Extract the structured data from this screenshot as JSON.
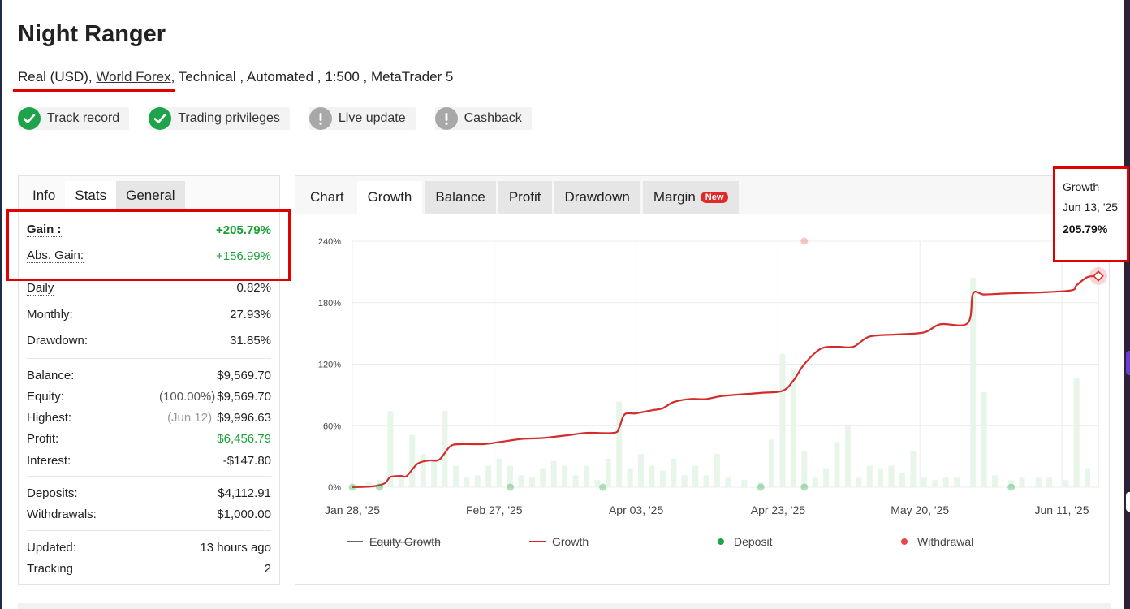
{
  "page": {
    "title": "Night Ranger",
    "subtitle": {
      "account": "Real (USD),",
      "broker": "World Forex",
      "rest": ", Technical , Automated , 1:500 , MetaTrader 5"
    }
  },
  "badges": [
    {
      "label": "Track record",
      "status": "ok",
      "icon": "check-icon"
    },
    {
      "label": "Trading privileges",
      "status": "ok",
      "icon": "check-icon"
    },
    {
      "label": "Live update",
      "status": "warn",
      "icon": "exclamation-icon"
    },
    {
      "label": "Cashback",
      "status": "warn",
      "icon": "exclamation-icon"
    }
  ],
  "left_tabs": {
    "info": "Info",
    "stats": "Stats",
    "general": "General"
  },
  "stats": {
    "gain": {
      "label": "Gain :",
      "value": "+205.79%"
    },
    "abs_gain": {
      "label": "Abs. Gain:",
      "value": "+156.99%"
    },
    "daily": {
      "label": "Daily",
      "value": "0.82%"
    },
    "monthly": {
      "label": "Monthly:",
      "value": "27.93%"
    },
    "drawdown": {
      "label": "Drawdown:",
      "value": "31.85%"
    },
    "balance": {
      "label": "Balance:",
      "value": "$9,569.70"
    },
    "equity": {
      "label": "Equity:",
      "note": "(100.00%)",
      "value": "$9,569.70"
    },
    "highest": {
      "label": "Highest:",
      "note": "(Jun 12)",
      "value": "$9,996.63"
    },
    "profit": {
      "label": "Profit:",
      "value": "$6,456.79"
    },
    "interest": {
      "label": "Interest:",
      "value": "-$147.80"
    },
    "deposits": {
      "label": "Deposits:",
      "value": "$4,112.91"
    },
    "withdrawals": {
      "label": "Withdrawals:",
      "value": "$1,000.00"
    },
    "updated": {
      "label": "Updated:",
      "value": "13 hours ago"
    },
    "tracking": {
      "label": "Tracking",
      "value": "2"
    }
  },
  "chart_tabs": {
    "chart": "Chart",
    "growth": "Growth",
    "balance": "Balance",
    "profit": "Profit",
    "drawdown": "Drawdown",
    "margin": "Margin",
    "new_badge": "New"
  },
  "tooltip": {
    "title": "Growth",
    "date": "Jun 13, '25",
    "value": "205.79%"
  },
  "colors": {
    "accent_red": "#e00000",
    "growth_line": "#d42b2b",
    "deposit_dot": "#1fa34a",
    "withdrawal_dot": "#e54848",
    "bar_fill": "#e8f5e9",
    "positive": "#18a034"
  },
  "chart_data": {
    "type": "line",
    "x_tick_labels": [
      "Jan 28, '25",
      "Feb 27, '25",
      "Apr 03, '25",
      "Apr 23, '25",
      "May 20, '25",
      "Jun 11, '25"
    ],
    "y_tick_labels": [
      "0%",
      "60%",
      "120%",
      "180%",
      "240%"
    ],
    "ylim": [
      0,
      240
    ],
    "x_range_days": [
      0,
      137
    ],
    "grid": true,
    "legend": [
      "Equity Growth",
      "Growth",
      "Deposit",
      "Withdrawal"
    ],
    "legend_placement": "bottom",
    "series": [
      {
        "name": "Growth",
        "points": [
          [
            0,
            0
          ],
          [
            4,
            1
          ],
          [
            6,
            4
          ],
          [
            7,
            10
          ],
          [
            9,
            11
          ],
          [
            10,
            11
          ],
          [
            12,
            23
          ],
          [
            14,
            26
          ],
          [
            16,
            27
          ],
          [
            18,
            40
          ],
          [
            20,
            42
          ],
          [
            24,
            42
          ],
          [
            27,
            44
          ],
          [
            31,
            47
          ],
          [
            35,
            48
          ],
          [
            40,
            51
          ],
          [
            43,
            53
          ],
          [
            48,
            53
          ],
          [
            49,
            58
          ],
          [
            50,
            71
          ],
          [
            52,
            72
          ],
          [
            55,
            75
          ],
          [
            57,
            77
          ],
          [
            59,
            83
          ],
          [
            62,
            86
          ],
          [
            65,
            86
          ],
          [
            68,
            89
          ],
          [
            75,
            92
          ],
          [
            79,
            94
          ],
          [
            81,
            104
          ],
          [
            83,
            120
          ],
          [
            86,
            135
          ],
          [
            89,
            137
          ],
          [
            92,
            137
          ],
          [
            95,
            147
          ],
          [
            100,
            149
          ],
          [
            105,
            151
          ],
          [
            108,
            159
          ],
          [
            113,
            160
          ],
          [
            114,
            189
          ],
          [
            116,
            188
          ],
          [
            120,
            189
          ],
          [
            126,
            190
          ],
          [
            132,
            192
          ],
          [
            133,
            197
          ],
          [
            135,
            205
          ],
          [
            137,
            206
          ]
        ]
      }
    ],
    "deposit_markers_days": [
      0,
      5,
      29,
      46,
      75,
      83,
      121
    ],
    "withdrawal_markers": [
      [
        83,
        240
      ]
    ],
    "tooltip_point": [
      137,
      206
    ],
    "daily_bars_relative": [
      [
        3,
        0.02
      ],
      [
        5,
        0.03
      ],
      [
        7,
        0.32
      ],
      [
        9,
        0.05
      ],
      [
        11,
        0.22
      ],
      [
        13,
        0.14
      ],
      [
        15,
        0.12
      ],
      [
        17,
        0.32
      ],
      [
        19,
        0.09
      ],
      [
        21,
        0.04
      ],
      [
        23,
        0.05
      ],
      [
        25,
        0.09
      ],
      [
        27,
        0.12
      ],
      [
        29,
        0.09
      ],
      [
        31,
        0.05
      ],
      [
        33,
        0.04
      ],
      [
        35,
        0.08
      ],
      [
        37,
        0.11
      ],
      [
        39,
        0.09
      ],
      [
        41,
        0.05
      ],
      [
        43,
        0.09
      ],
      [
        45,
        0.03
      ],
      [
        47,
        0.12
      ],
      [
        49,
        0.36
      ],
      [
        51,
        0.08
      ],
      [
        53,
        0.14
      ],
      [
        55,
        0.09
      ],
      [
        57,
        0.07
      ],
      [
        59,
        0.12
      ],
      [
        61,
        0.05
      ],
      [
        63,
        0.09
      ],
      [
        65,
        0.05
      ],
      [
        67,
        0.14
      ],
      [
        69,
        0.04
      ],
      [
        72,
        0.03
      ],
      [
        75,
        0.02
      ],
      [
        77,
        0.2
      ],
      [
        79,
        0.56
      ],
      [
        81,
        0.5
      ],
      [
        83,
        0.15
      ],
      [
        85,
        0.04
      ],
      [
        87,
        0.08
      ],
      [
        89,
        0.19
      ],
      [
        91,
        0.26
      ],
      [
        93,
        0.04
      ],
      [
        95,
        0.09
      ],
      [
        97,
        0.08
      ],
      [
        99,
        0.09
      ],
      [
        101,
        0.06
      ],
      [
        103,
        0.15
      ],
      [
        105,
        0.04
      ],
      [
        107,
        0.03
      ],
      [
        109,
        0.04
      ],
      [
        111,
        0.04
      ],
      [
        114,
        0.88
      ],
      [
        116,
        0.4
      ],
      [
        118,
        0.05
      ],
      [
        121,
        0.03
      ],
      [
        123,
        0.04
      ],
      [
        126,
        0.04
      ],
      [
        128,
        0.04
      ],
      [
        131,
        0.03
      ],
      [
        133,
        0.46
      ],
      [
        135,
        0.08
      ]
    ]
  }
}
